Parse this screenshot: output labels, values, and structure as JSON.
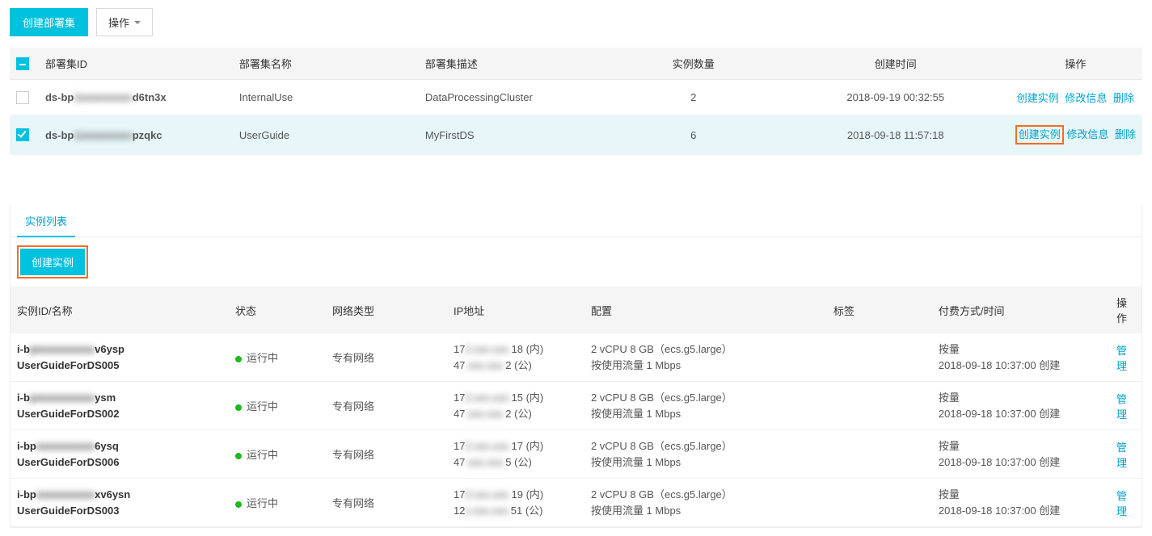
{
  "toolbar": {
    "create_ds": "创建部署集",
    "actions": "操作"
  },
  "ds_headers": {
    "id": "部署集ID",
    "name": "部署集名称",
    "desc": "部署集描述",
    "count": "实例数量",
    "createTime": "创建时间",
    "ops": "操作"
  },
  "ds_rows": [
    {
      "id_pre": "ds-bp",
      "id_mid": "1xxxxxxxxx",
      "id_suf": "d6tn3x",
      "name": "InternalUse",
      "desc": "DataProcessingCluster",
      "count": "2",
      "createTime": "2018-09-19 00:32:55",
      "selected": false
    },
    {
      "id_pre": "ds-bp",
      "id_mid": "1xxxxxxxxx",
      "id_suf": "pzqkc",
      "name": "UserGuide",
      "desc": "MyFirstDS",
      "count": "6",
      "createTime": "2018-09-18 11:57:18",
      "selected": true
    }
  ],
  "row_ops": {
    "create_instance": "创建实例",
    "modify_info": "修改信息",
    "delete": "删除"
  },
  "tabs": {
    "instance_list": "实例列表"
  },
  "lower_toolbar": {
    "create_instance": "创建实例"
  },
  "inst_headers": {
    "idname": "实例ID/名称",
    "status": "状态",
    "netType": "网络类型",
    "ip": "IP地址",
    "config": "配置",
    "tags": "标签",
    "payTime": "付费方式/时间",
    "ops": "操作"
  },
  "inst_common": {
    "status_text": "运行中",
    "netType": "专有网络",
    "config1": "2 vCPU 8 GB（ecs.g5.large）",
    "config2": "按使用流量 1 Mbps",
    "pay1": "按量",
    "pay2": "2018-09-18 10:37:00 创建",
    "manage": "管理",
    "ip_in_suffix": " (内)",
    "ip_pub_suffix": " (公)"
  },
  "inst_rows": [
    {
      "id_pre": "i-b",
      "id_mid": "pxxxxxxxxxx",
      "id_suf": "v6ysp",
      "name": "UserGuideForDS005",
      "ip1_pre": "17",
      "ip1_mid": "2.xxx.xxx.",
      "ip1_suf": "18",
      "ip2_pre": "47",
      "ip2_mid": ".xxx.xxx.",
      "ip2_suf": "2"
    },
    {
      "id_pre": "i-b",
      "id_mid": "pxxxxxxxxxx",
      "id_suf": "ysm",
      "name": "UserGuideForDS002",
      "ip1_pre": "17",
      "ip1_mid": "2.xxx.xxx.",
      "ip1_suf": "15",
      "ip2_pre": "47",
      "ip2_mid": ".xxx.xxx.",
      "ip2_suf": "2"
    },
    {
      "id_pre": "i-bp",
      "id_mid": "xxxxxxxxxx",
      "id_suf": "6ysq",
      "name": "UserGuideForDS006",
      "ip1_pre": "17",
      "ip1_mid": "2.xxx.xxx.",
      "ip1_suf": "17",
      "ip2_pre": "47",
      "ip2_mid": ".xxx.xxx.",
      "ip2_suf": "5"
    },
    {
      "id_pre": "i-bp",
      "id_mid": "xxxxxxxxxx",
      "id_suf": "xv6ysn",
      "name": "UserGuideForDS003",
      "ip1_pre": "17",
      "ip1_mid": "2.xxx.xxx.",
      "ip1_suf": "19",
      "ip2_pre": "12",
      "ip2_mid": "x.xxx.xxx.",
      "ip2_suf": "51"
    }
  ]
}
